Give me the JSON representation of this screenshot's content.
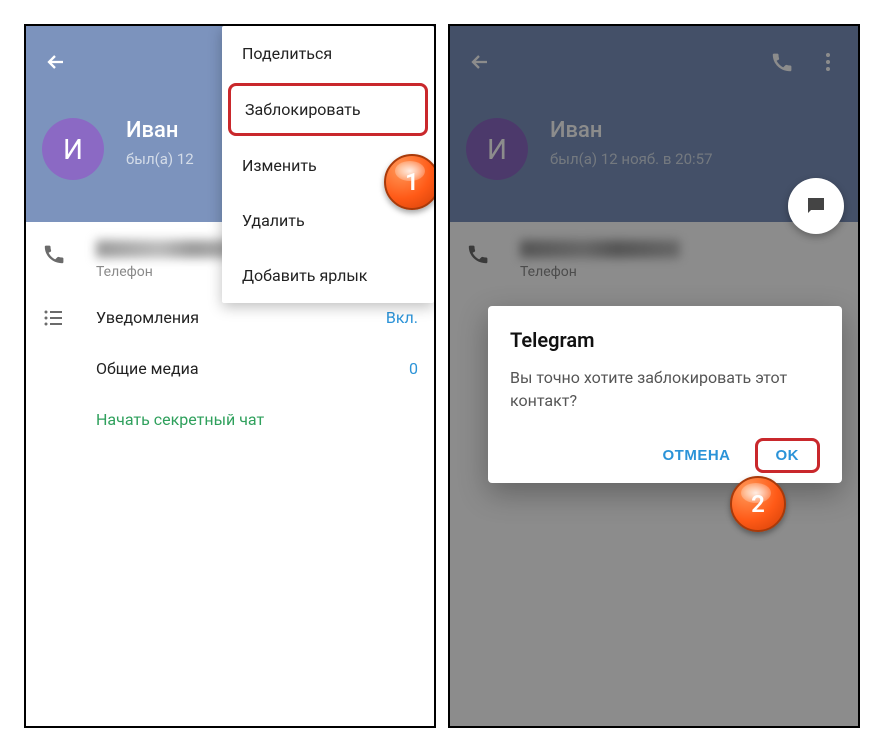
{
  "left": {
    "contact_name": "Иван",
    "contact_initial": "И",
    "last_seen": "был(а) 12",
    "phone_label": "Телефон",
    "notifications_label": "Уведомления",
    "notifications_value": "Вкл.",
    "shared_media_label": "Общие медиа",
    "shared_media_value": "0",
    "secret_chat_label": "Начать секретный чат",
    "menu": {
      "share": "Поделиться",
      "block": "Заблокировать",
      "edit": "Изменить",
      "delete": "Удалить",
      "add_shortcut": "Добавить ярлык"
    },
    "badge": "1"
  },
  "right": {
    "contact_name": "Иван",
    "contact_initial": "И",
    "last_seen": "был(а) 12 нояб. в 20:57",
    "phone_label": "Телефон",
    "dialog": {
      "title": "Telegram",
      "message": "Вы точно хотите заблокировать этот контакт?",
      "cancel": "ОТМЕНА",
      "ok": "OK"
    },
    "badge": "2"
  },
  "colors": {
    "header_bg": "#7c93bd",
    "avatar_bg": "#8b69c4",
    "accent": "#2b93d8",
    "highlight_border": "#c9282c",
    "badge_bg": "#ff5a17"
  }
}
